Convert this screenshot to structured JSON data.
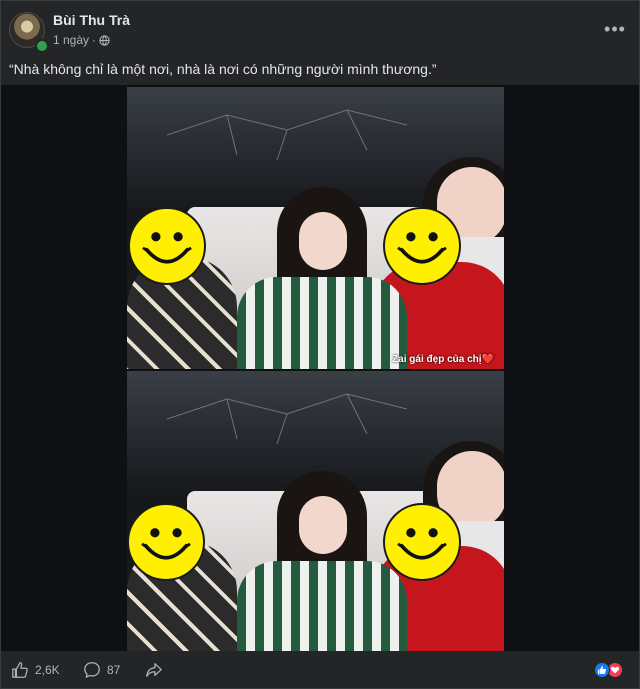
{
  "post": {
    "author": "Bùi Thu Trà",
    "time": "1 ngày",
    "privacy_separator": "·",
    "more_label": "•••",
    "caption": "“Nhà không chỉ là một nơi, nhà là nơi có những người mình thương.”"
  },
  "photos": {
    "top_caption": "Zai gái đẹp của chị❤️"
  },
  "actions": {
    "like_count": "2,6K",
    "comment_count": "87"
  },
  "colors": {
    "card_bg": "#242526",
    "page_bg": "#0f1013",
    "online": "#31a24c",
    "like_blue": "#1877f2",
    "love_red": "#f33e58",
    "smiley_yellow": "#ffef00"
  },
  "icons": [
    "globe-icon",
    "more-icon",
    "like-icon",
    "comment-icon",
    "share-icon",
    "reaction-like-icon",
    "reaction-love-icon"
  ]
}
